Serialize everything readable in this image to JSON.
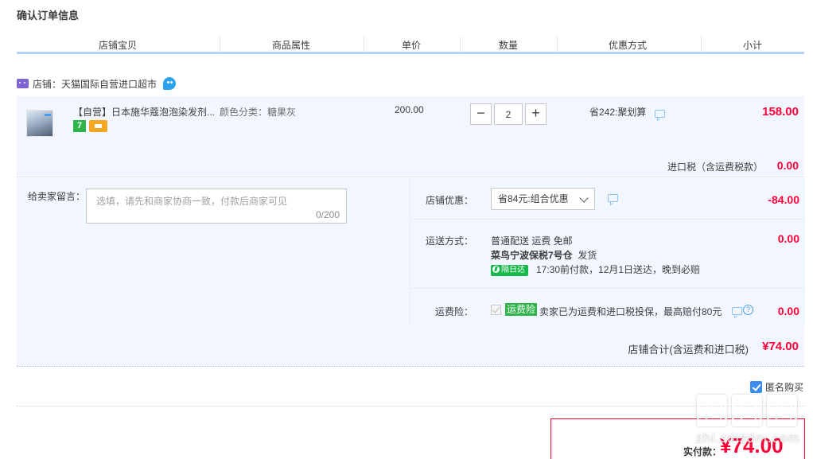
{
  "page": {
    "title": "确认订单信息"
  },
  "columns": [
    "店铺宝贝",
    "商品属性",
    "单价",
    "数量",
    "优惠方式",
    "小计"
  ],
  "shop": {
    "label": "店铺：天猫国际自营进口超市"
  },
  "item": {
    "name": "【自营】日本施华蔻泡泡染发剂...",
    "attribute": "颜色分类：糖果灰",
    "unit_price": "200.00",
    "quantity": "2",
    "qty_minus": "−",
    "qty_plus": "+",
    "discount": "省242:聚划算",
    "subtotal": "158.00",
    "tag_seven": "7",
    "tax_label": "进口税（含运费税款）",
    "tax_value": "0.00"
  },
  "remark": {
    "label": "给卖家留言：",
    "placeholder": "选填，请先和商家协商一致，付款后商家可见",
    "count": "0/200"
  },
  "coupon": {
    "label": "店铺优惠：",
    "selected": "省84元:组合优惠",
    "value": "-84.00"
  },
  "shipping": {
    "label": "运送方式：",
    "line1": "普通配送 运费 免邮",
    "line2_bold": "菜鸟宁波保税7号仓",
    "line2_rest": "发货",
    "badge": "隔日达",
    "line3": "17:30前付款，12月1日送达，晚到必赔",
    "value": "0.00"
  },
  "insurance": {
    "label": "运费险：",
    "badge": "运费险",
    "text": "卖家已为运费和进口税投保，最高赔付80元",
    "help": "?",
    "value": "0.00"
  },
  "shop_total": {
    "label": "店铺合计(含运费和进口税)",
    "value": "¥74.00"
  },
  "anonymous": {
    "label": "匿名购买"
  },
  "payment": {
    "label": "实付款：",
    "value": "¥74.00"
  },
  "watermark": {
    "text": "zhi.smzdm.com"
  },
  "colors": {
    "price_red": "#ff0036",
    "header_blue": "#b2d1ff",
    "row_bg": "#f2f7ff",
    "tag_green": "#2db54a"
  }
}
